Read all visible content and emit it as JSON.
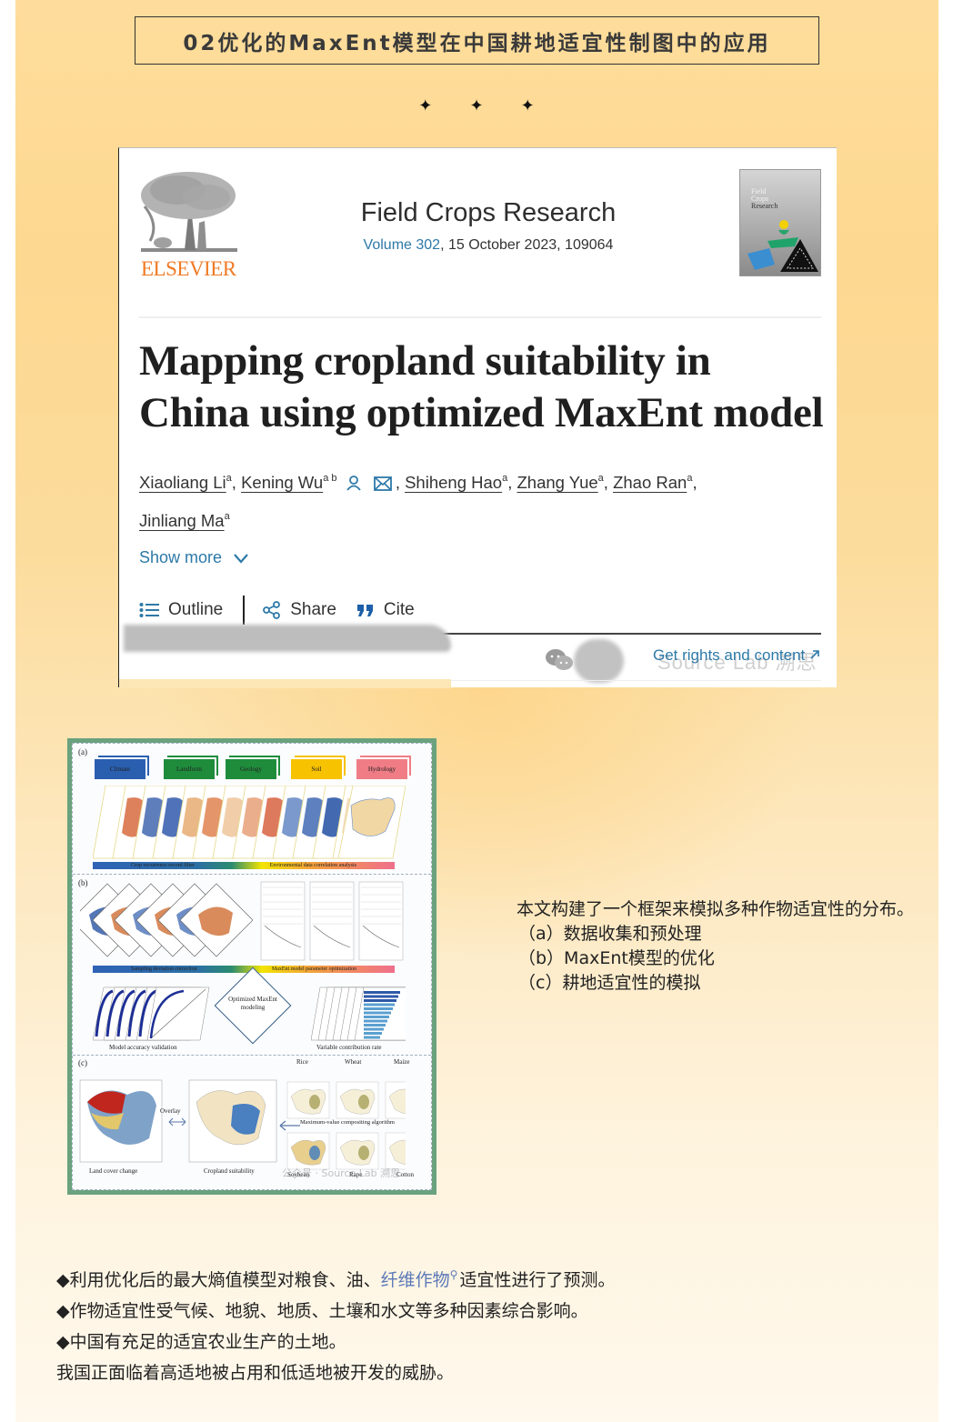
{
  "header": {
    "section_title": "02优化的MaxEnt模型在中国耕地适宜性制图中的应用",
    "decoration": [
      "✦",
      "✦",
      "✦"
    ]
  },
  "article_card": {
    "publisher": "ELSEVIER",
    "journal_name": "Field Crops Research",
    "volume_link": "Volume 302",
    "volume_rest": ", 15 October 2023, 109064",
    "cover": {
      "line1": "Field",
      "line2": "Crops",
      "line3": "Research"
    },
    "title": "Mapping cropland suitability in China using optimized MaxEnt model",
    "authors": [
      {
        "name": "Xiaoliang Li",
        "aff": "a"
      },
      {
        "name": "Kening Wu",
        "aff": "a b",
        "corresponding": true
      },
      {
        "name": "Shiheng Hao",
        "aff": "a"
      },
      {
        "name": "Zhang Yue",
        "aff": "a"
      },
      {
        "name": "Zhao Ran",
        "aff": "a"
      },
      {
        "name": "Jinliang Ma",
        "aff": "a"
      }
    ],
    "show_more": "Show more",
    "toolbar": {
      "outline": "Outline",
      "share": "Share",
      "cite": "Cite"
    },
    "rights_link": "Get rights and content",
    "watermark": "Source Lab 溯思"
  },
  "figure": {
    "panel_a": "(a)",
    "panel_b": "(b)",
    "panel_c": "(c)",
    "categories": [
      "Climate",
      "Landform",
      "Geology",
      "Soil",
      "Hydrology"
    ],
    "category_colors": [
      "#2a5fb0",
      "#1f8c3c",
      "#1f8c3c",
      "#f7c200",
      "#f07d86"
    ],
    "bar_a": [
      "Crop occurrence record filter",
      "Environmental data correlation analysis"
    ],
    "bar_b": [
      "Sampling deviation correction",
      "MaxEnt model parameter optimization"
    ],
    "center": "Optimized MaxEnt modeling",
    "left_caption": "Model accuracy validation",
    "right_caption": "Variable contribution rate",
    "crops_top": [
      "Rice",
      "Wheat",
      "Maize"
    ],
    "crops_bottom": [
      "Soybean",
      "Rape",
      "Cotton"
    ],
    "overlay": "Overlay",
    "algorithm": "Maximum-value compositing algorithm",
    "land_cover": "Land cover change",
    "cropland_suitability": "Cropland suitability",
    "watermark": "公众号 · Source Lab 溯思"
  },
  "description": {
    "intro": "本文构建了一个框架来模拟多种作物适宜性的分布。",
    "items": [
      "（a）数据收集和预处理",
      "（b）MaxEnt模型的优化",
      "（c）耕地适宜性的模拟"
    ]
  },
  "bullets": {
    "line1_pre": "◆利用优化后的最大熵值模型对粮食、油、",
    "line1_link": "纤维作物",
    "line1_post": "适宜性进行了预测。",
    "line2": "◆作物适宜性受气候、地貌、地质、土壤和水文等多种因素综合影响。",
    "line3": "◆中国有充足的适宜农业生产的土地。",
    "line4": "我国正面临着高适地被占用和低适地被开发的威胁。"
  },
  "colors": {
    "link_blue": "#2d79a8",
    "elsevier_orange": "#f07a24",
    "figure_frame": "#6aa27e",
    "term_link": "#5b79b8"
  }
}
